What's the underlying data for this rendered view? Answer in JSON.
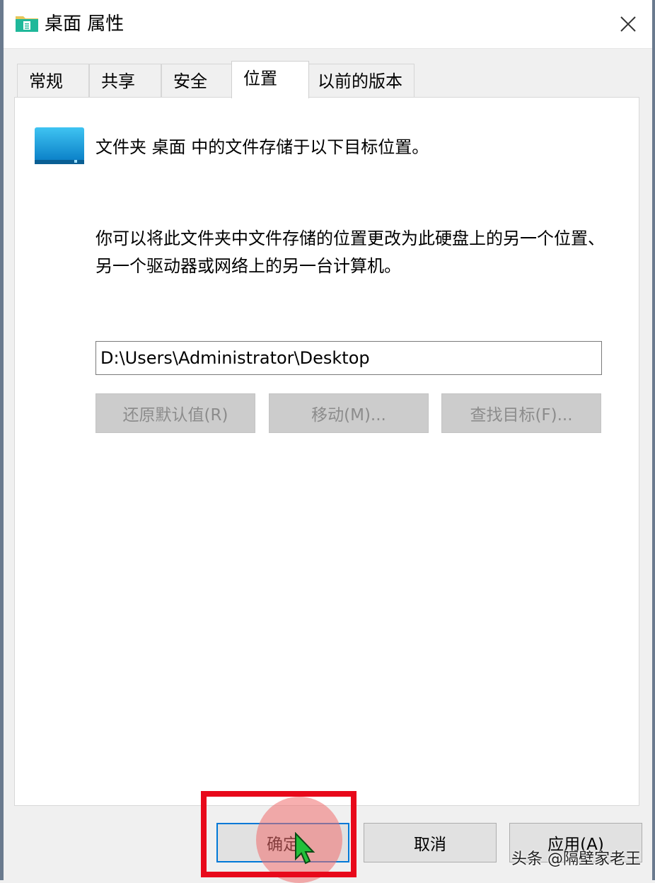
{
  "window": {
    "title": "桌面 属性",
    "title_icon": "folder-icon",
    "close_icon": "close-icon"
  },
  "tabs": [
    {
      "label": "常规",
      "active": false
    },
    {
      "label": "共享",
      "active": false
    },
    {
      "label": "安全",
      "active": false
    },
    {
      "label": "位置",
      "active": true
    },
    {
      "label": "以前的版本",
      "active": false
    }
  ],
  "location": {
    "intro": "文件夹 桌面 中的文件存储于以下目标位置。",
    "description": "你可以将此文件夹中文件存储的位置更改为此硬盘上的另一个位置、另一个驱动器或网络上的另一台计算机。",
    "path": "D:\\Users\\Administrator\\Desktop",
    "buttons": {
      "restore": "还原默认值(R)",
      "move": "移动(M)...",
      "find_target": "查找目标(F)..."
    }
  },
  "footer": {
    "ok": "确定",
    "cancel": "取消",
    "apply": "应用(A)"
  },
  "watermark": "头条 @隔壁家老王",
  "colors": {
    "accent": "#0078d7",
    "highlight": "#e8091b",
    "disabled_bg": "#cccccc",
    "disabled_text": "#8c8c8c"
  }
}
